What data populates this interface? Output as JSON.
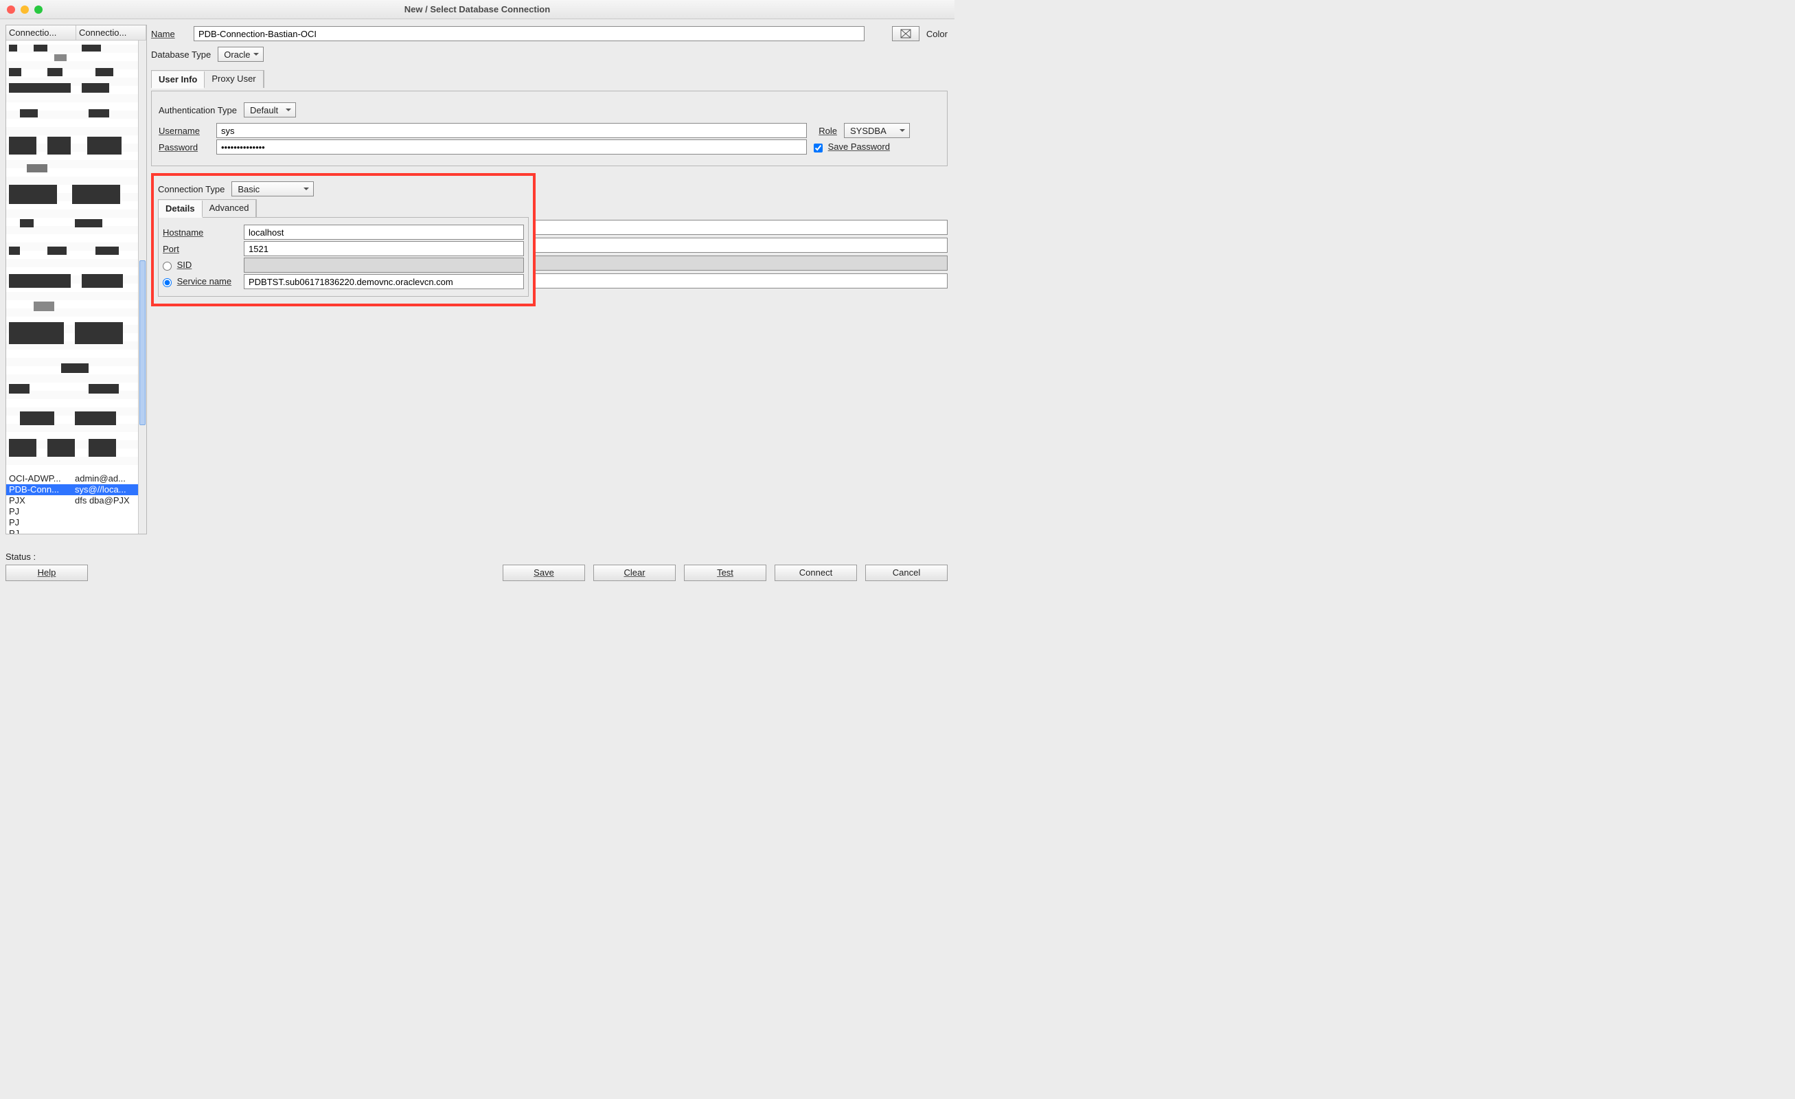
{
  "window": {
    "title": "New / Select Database Connection"
  },
  "left": {
    "columns": [
      "Connectio...",
      "Connectio..."
    ],
    "visibleRows": [
      {
        "name": "OCI-ADWP...",
        "detail": "admin@ad..."
      },
      {
        "name": "PDB-Conn...",
        "detail": "sys@//loca...",
        "selected": true
      },
      {
        "name": "PJX",
        "detail": "dfs dba@PJX"
      },
      {
        "name": "PJ",
        "detail": ""
      },
      {
        "name": "PJ",
        "detail": ""
      },
      {
        "name": "PJ",
        "detail": ""
      }
    ]
  },
  "form": {
    "name_label": "Name",
    "name_value": "PDB-Connection-Bastian-OCI",
    "color_label": "Color",
    "dbtype_label": "Database Type",
    "dbtype_value": "Oracle",
    "tabs": {
      "user_info": "User Info",
      "proxy_user": "Proxy User",
      "active": "user_info"
    },
    "auth_label": "Authentication Type",
    "auth_value": "Default",
    "username_label": "Username",
    "username_value": "sys",
    "role_label": "Role",
    "role_value": "SYSDBA",
    "password_label": "Password",
    "password_value": "••••••••••••••",
    "save_pw_label": "Save Password",
    "save_pw_checked": true,
    "conn_type_label": "Connection Type",
    "conn_type_value": "Basic",
    "detail_tabs": {
      "details": "Details",
      "advanced": "Advanced",
      "active": "details"
    },
    "hostname_label": "Hostname",
    "hostname_value": "localhost",
    "port_label": "Port",
    "port_value": "1521",
    "sid_label": "SID",
    "sid_value": "",
    "service_label": "Service name",
    "service_value": "PDBTST.sub06171836220.demovnc.oraclevcn.com",
    "service_selected": true
  },
  "status_label": "Status :",
  "buttons": {
    "help": "Help",
    "save": "Save",
    "clear": "Clear",
    "test": "Test",
    "connect": "Connect",
    "cancel": "Cancel"
  }
}
